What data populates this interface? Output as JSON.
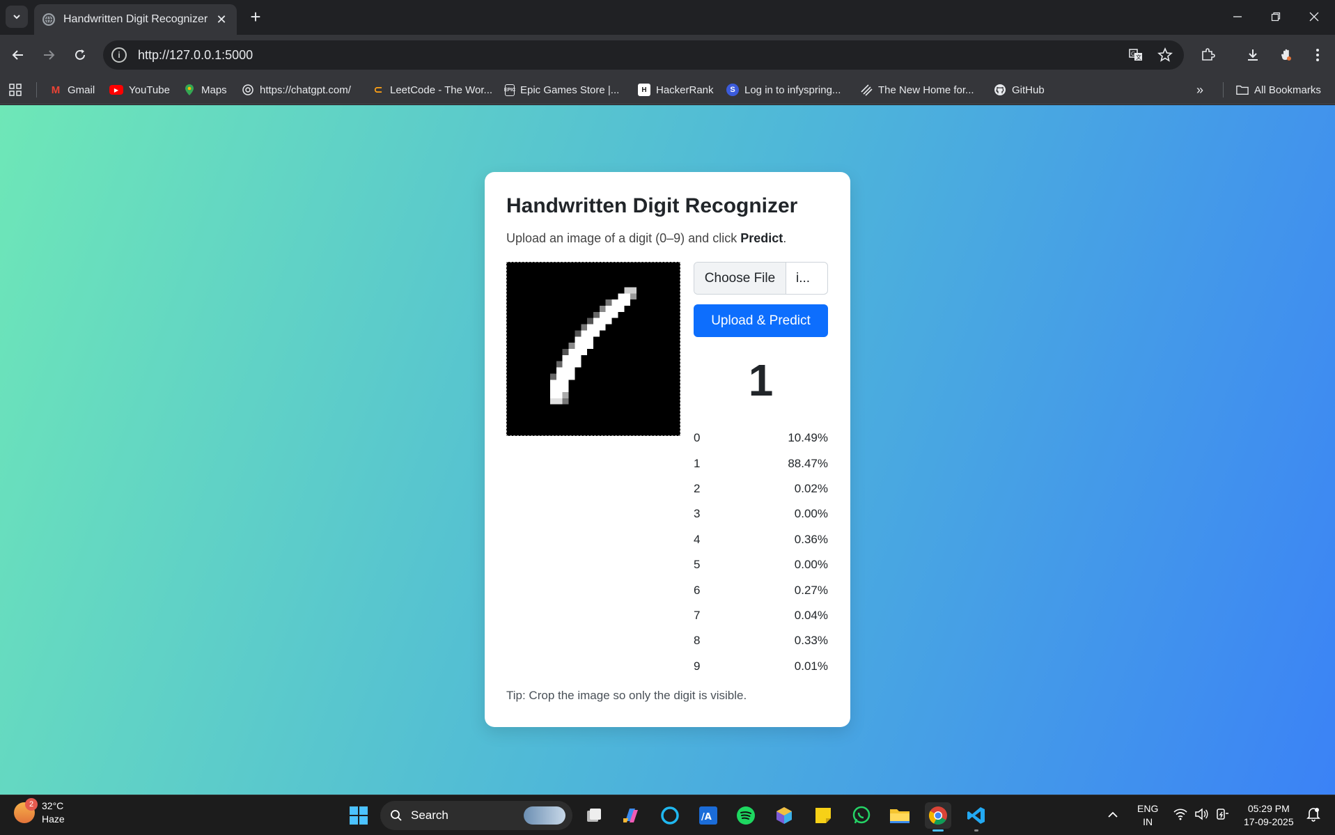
{
  "browser": {
    "tab_title": "Handwritten Digit Recognizer",
    "url": "http://127.0.0.1:5000",
    "bookmarks": [
      {
        "label": "Gmail",
        "icon": "gmail-icon"
      },
      {
        "label": "YouTube",
        "icon": "youtube-icon"
      },
      {
        "label": "Maps",
        "icon": "maps-icon"
      },
      {
        "label": "https://chatgpt.com/",
        "icon": "chatgpt-icon"
      },
      {
        "label": "LeetCode - The Wor...",
        "icon": "leetcode-icon"
      },
      {
        "label": "Epic Games Store |...",
        "icon": "epic-games-icon"
      },
      {
        "label": "HackerRank",
        "icon": "hackerrank-icon"
      },
      {
        "label": "Log in to infyspring...",
        "icon": "infyspring-icon"
      },
      {
        "label": "The New Home for...",
        "icon": "stack-icon"
      },
      {
        "label": "GitHub",
        "icon": "github-icon"
      }
    ],
    "all_bookmarks_label": "All Bookmarks"
  },
  "app": {
    "title": "Handwritten Digit Recognizer",
    "subtitle_prefix": "Upload an image of a digit (0–9) and click ",
    "subtitle_bold": "Predict",
    "subtitle_suffix": ".",
    "choose_file_label": "Choose File",
    "file_name": "i...",
    "predict_button": "Upload & Predict",
    "prediction": "1",
    "probabilities": [
      {
        "digit": "0",
        "prob": "10.49%"
      },
      {
        "digit": "1",
        "prob": "88.47%"
      },
      {
        "digit": "2",
        "prob": "0.02%"
      },
      {
        "digit": "3",
        "prob": "0.00%"
      },
      {
        "digit": "4",
        "prob": "0.36%"
      },
      {
        "digit": "5",
        "prob": "0.00%"
      },
      {
        "digit": "6",
        "prob": "0.27%"
      },
      {
        "digit": "7",
        "prob": "0.04%"
      },
      {
        "digit": "8",
        "prob": "0.33%"
      },
      {
        "digit": "9",
        "prob": "0.01%"
      }
    ],
    "tip": "Tip: Crop the image so only the digit is visible.",
    "accent_color": "#0d6efd"
  },
  "taskbar": {
    "weather_badge": "2",
    "temperature": "32°C",
    "condition": "Haze",
    "search_label": "Search",
    "lang_line1": "ENG",
    "lang_line2": "IN",
    "time": "05:29 PM",
    "date": "17-09-2025"
  }
}
